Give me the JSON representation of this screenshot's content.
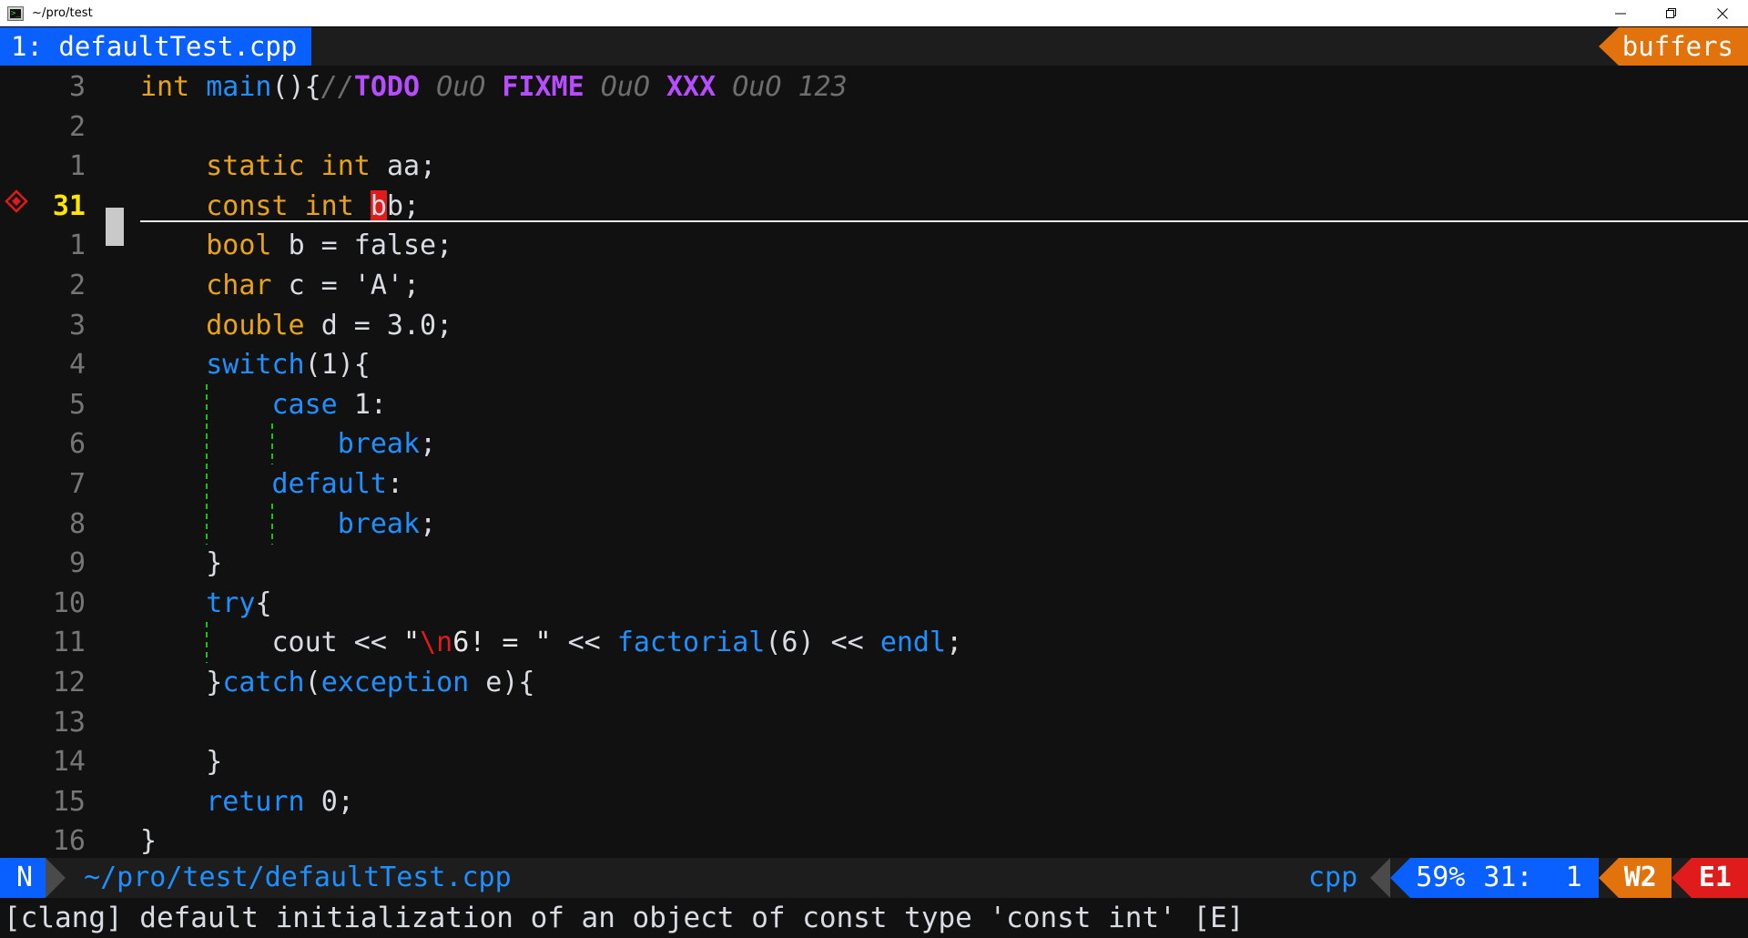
{
  "window": {
    "title": "~/pro/test",
    "icon": "terminal-icon",
    "controls": [
      {
        "name": "minimize",
        "glyph": "minimize-icon"
      },
      {
        "name": "maximize",
        "glyph": "maximize-icon"
      },
      {
        "name": "close",
        "glyph": "close-icon"
      }
    ]
  },
  "tabline": {
    "active_buffer": "1: defaultTest.cpp",
    "right_label": "buffers"
  },
  "editor": {
    "cursor_line": 31,
    "lines": [
      {
        "num": "3",
        "sign": "",
        "current": false,
        "segments": [
          {
            "t": "int ",
            "c": "c-type"
          },
          {
            "t": "main",
            "c": "c-fn"
          },
          {
            "t": "(){",
            "c": "c-punct"
          },
          {
            "t": "//",
            "c": "c-comment"
          },
          {
            "t": "TODO",
            "c": "c-todo"
          },
          {
            "t": " OuO ",
            "c": "c-comment"
          },
          {
            "t": "FIXME",
            "c": "c-todo"
          },
          {
            "t": " OuO ",
            "c": "c-comment"
          },
          {
            "t": "XXX",
            "c": "c-todo"
          },
          {
            "t": " OuO 123",
            "c": "c-comment"
          }
        ]
      },
      {
        "num": "2",
        "sign": "",
        "current": false,
        "segments": []
      },
      {
        "num": "1",
        "sign": "",
        "current": false,
        "segments": [
          {
            "t": "    ",
            "c": "c-punct"
          },
          {
            "t": "static int ",
            "c": "c-type"
          },
          {
            "t": "aa;",
            "c": "c-ident"
          }
        ]
      },
      {
        "num": "31",
        "sign": "error-diamond",
        "current": true,
        "segments": [
          {
            "t": "    ",
            "c": "c-punct"
          },
          {
            "t": "const int ",
            "c": "c-type"
          },
          {
            "t": "b",
            "c": "c-cursor"
          },
          {
            "t": "b;",
            "c": "c-ident"
          }
        ]
      },
      {
        "num": "1",
        "sign": "",
        "current": false,
        "segments": [
          {
            "t": "    ",
            "c": "c-punct"
          },
          {
            "t": "bool ",
            "c": "c-type"
          },
          {
            "t": "b = false;",
            "c": "c-ident"
          }
        ]
      },
      {
        "num": "2",
        "sign": "",
        "current": false,
        "segments": [
          {
            "t": "    ",
            "c": "c-punct"
          },
          {
            "t": "char ",
            "c": "c-type"
          },
          {
            "t": "c = 'A';",
            "c": "c-ident"
          }
        ]
      },
      {
        "num": "3",
        "sign": "",
        "current": false,
        "segments": [
          {
            "t": "    ",
            "c": "c-punct"
          },
          {
            "t": "double ",
            "c": "c-type"
          },
          {
            "t": "d = 3.0;",
            "c": "c-ident"
          }
        ]
      },
      {
        "num": "4",
        "sign": "",
        "current": false,
        "segments": [
          {
            "t": "    ",
            "c": "c-punct"
          },
          {
            "t": "switch",
            "c": "c-kw"
          },
          {
            "t": "(1){",
            "c": "c-punct"
          }
        ]
      },
      {
        "num": "5",
        "sign": "",
        "current": false,
        "guides": [
          1
        ],
        "segments": [
          {
            "t": "        ",
            "c": "c-punct"
          },
          {
            "t": "case ",
            "c": "c-kw"
          },
          {
            "t": "1:",
            "c": "c-num"
          }
        ]
      },
      {
        "num": "6",
        "sign": "",
        "current": false,
        "guides": [
          1,
          2
        ],
        "segments": [
          {
            "t": "            ",
            "c": "c-punct"
          },
          {
            "t": "break",
            "c": "c-kw"
          },
          {
            "t": ";",
            "c": "c-punct"
          }
        ]
      },
      {
        "num": "7",
        "sign": "",
        "current": false,
        "guides": [
          1
        ],
        "segments": [
          {
            "t": "        ",
            "c": "c-punct"
          },
          {
            "t": "default",
            "c": "c-kw"
          },
          {
            "t": ":",
            "c": "c-punct"
          }
        ]
      },
      {
        "num": "8",
        "sign": "",
        "current": false,
        "guides": [
          1,
          2
        ],
        "segments": [
          {
            "t": "            ",
            "c": "c-punct"
          },
          {
            "t": "break",
            "c": "c-kw"
          },
          {
            "t": ";",
            "c": "c-punct"
          }
        ]
      },
      {
        "num": "9",
        "sign": "",
        "current": false,
        "segments": [
          {
            "t": "    }",
            "c": "c-punct"
          }
        ]
      },
      {
        "num": "10",
        "sign": "",
        "current": false,
        "segments": [
          {
            "t": "    ",
            "c": "c-punct"
          },
          {
            "t": "try",
            "c": "c-kw"
          },
          {
            "t": "{",
            "c": "c-punct"
          }
        ]
      },
      {
        "num": "11",
        "sign": "",
        "current": false,
        "guides": [
          1
        ],
        "segments": [
          {
            "t": "        ",
            "c": "c-punct"
          },
          {
            "t": "cout << ",
            "c": "c-ident"
          },
          {
            "t": "\"",
            "c": "c-str"
          },
          {
            "t": "\\n",
            "c": "c-esc"
          },
          {
            "t": "6! = \"",
            "c": "c-str"
          },
          {
            "t": " << ",
            "c": "c-ident"
          },
          {
            "t": "factorial",
            "c": "c-fn"
          },
          {
            "t": "(6) << ",
            "c": "c-ident"
          },
          {
            "t": "endl",
            "c": "c-fn"
          },
          {
            "t": ";",
            "c": "c-punct"
          }
        ]
      },
      {
        "num": "12",
        "sign": "",
        "current": false,
        "segments": [
          {
            "t": "    }",
            "c": "c-punct"
          },
          {
            "t": "catch",
            "c": "c-kw"
          },
          {
            "t": "(",
            "c": "c-punct"
          },
          {
            "t": "exception",
            "c": "c-kw"
          },
          {
            "t": " e){",
            "c": "c-punct"
          }
        ]
      },
      {
        "num": "13",
        "sign": "",
        "current": false,
        "segments": []
      },
      {
        "num": "14",
        "sign": "",
        "current": false,
        "segments": [
          {
            "t": "    }",
            "c": "c-punct"
          }
        ]
      },
      {
        "num": "15",
        "sign": "",
        "current": false,
        "segments": [
          {
            "t": "    ",
            "c": "c-punct"
          },
          {
            "t": "return ",
            "c": "c-kw"
          },
          {
            "t": "0;",
            "c": "c-num"
          }
        ]
      },
      {
        "num": "16",
        "sign": "",
        "current": false,
        "segments": [
          {
            "t": "}",
            "c": "c-punct"
          }
        ]
      }
    ]
  },
  "statusline": {
    "mode": "N",
    "path": "~/pro/test/defaultTest.cpp",
    "filetype": "cpp",
    "percent": "59%",
    "position": "31:  1",
    "warnings": "W2",
    "errors": "E1"
  },
  "cmdline": {
    "message": "[clang] default initialization of an object of const type 'const int' [E]"
  },
  "colors": {
    "accent_blue": "#0a60ff",
    "accent_orange": "#e2720c",
    "accent_red": "#e01b1b",
    "background": "#111111",
    "guide_green": "#14c414"
  }
}
